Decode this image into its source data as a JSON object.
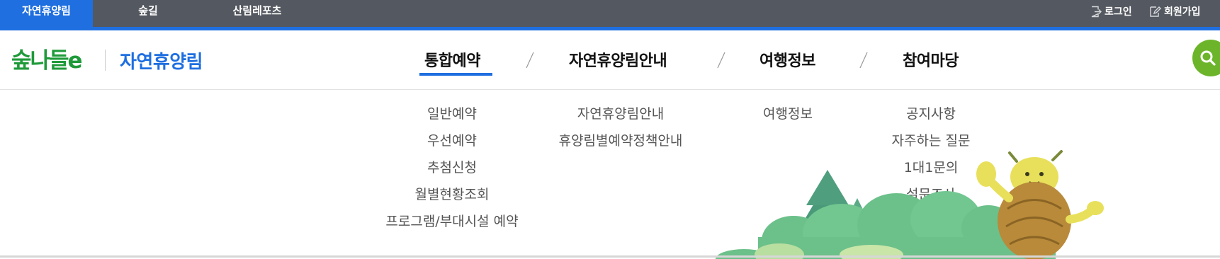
{
  "top_tabs": [
    "자연휴양림",
    "숲길",
    "산림레포츠"
  ],
  "utility": {
    "login": "로그인",
    "signup": "회원가입"
  },
  "logo": {
    "text": "숲나들e"
  },
  "site_name": "자연휴양림",
  "gnb": [
    "통합예약",
    "자연휴양림안내",
    "여행정보",
    "참여마당"
  ],
  "submenu": {
    "reservation": [
      "일반예약",
      "우선예약",
      "추첨신청",
      "월별현황조회",
      "프로그램/부대시설 예약"
    ],
    "guide": [
      "자연휴양림안내",
      "휴양림별예약정책안내"
    ],
    "travel": [
      "여행정보"
    ],
    "community": [
      "공지사항",
      "자주하는 질문",
      "1대1문의",
      "설문조사"
    ]
  },
  "colors": {
    "topbar": "#545860",
    "accent_blue": "#1f6fe0",
    "search_green": "#6cb52b",
    "logo_green": "#1f9a3a"
  },
  "icons": {
    "login": "login-icon",
    "signup": "signup-icon",
    "search": "search-icon",
    "mascot": "mascot-illustration"
  }
}
